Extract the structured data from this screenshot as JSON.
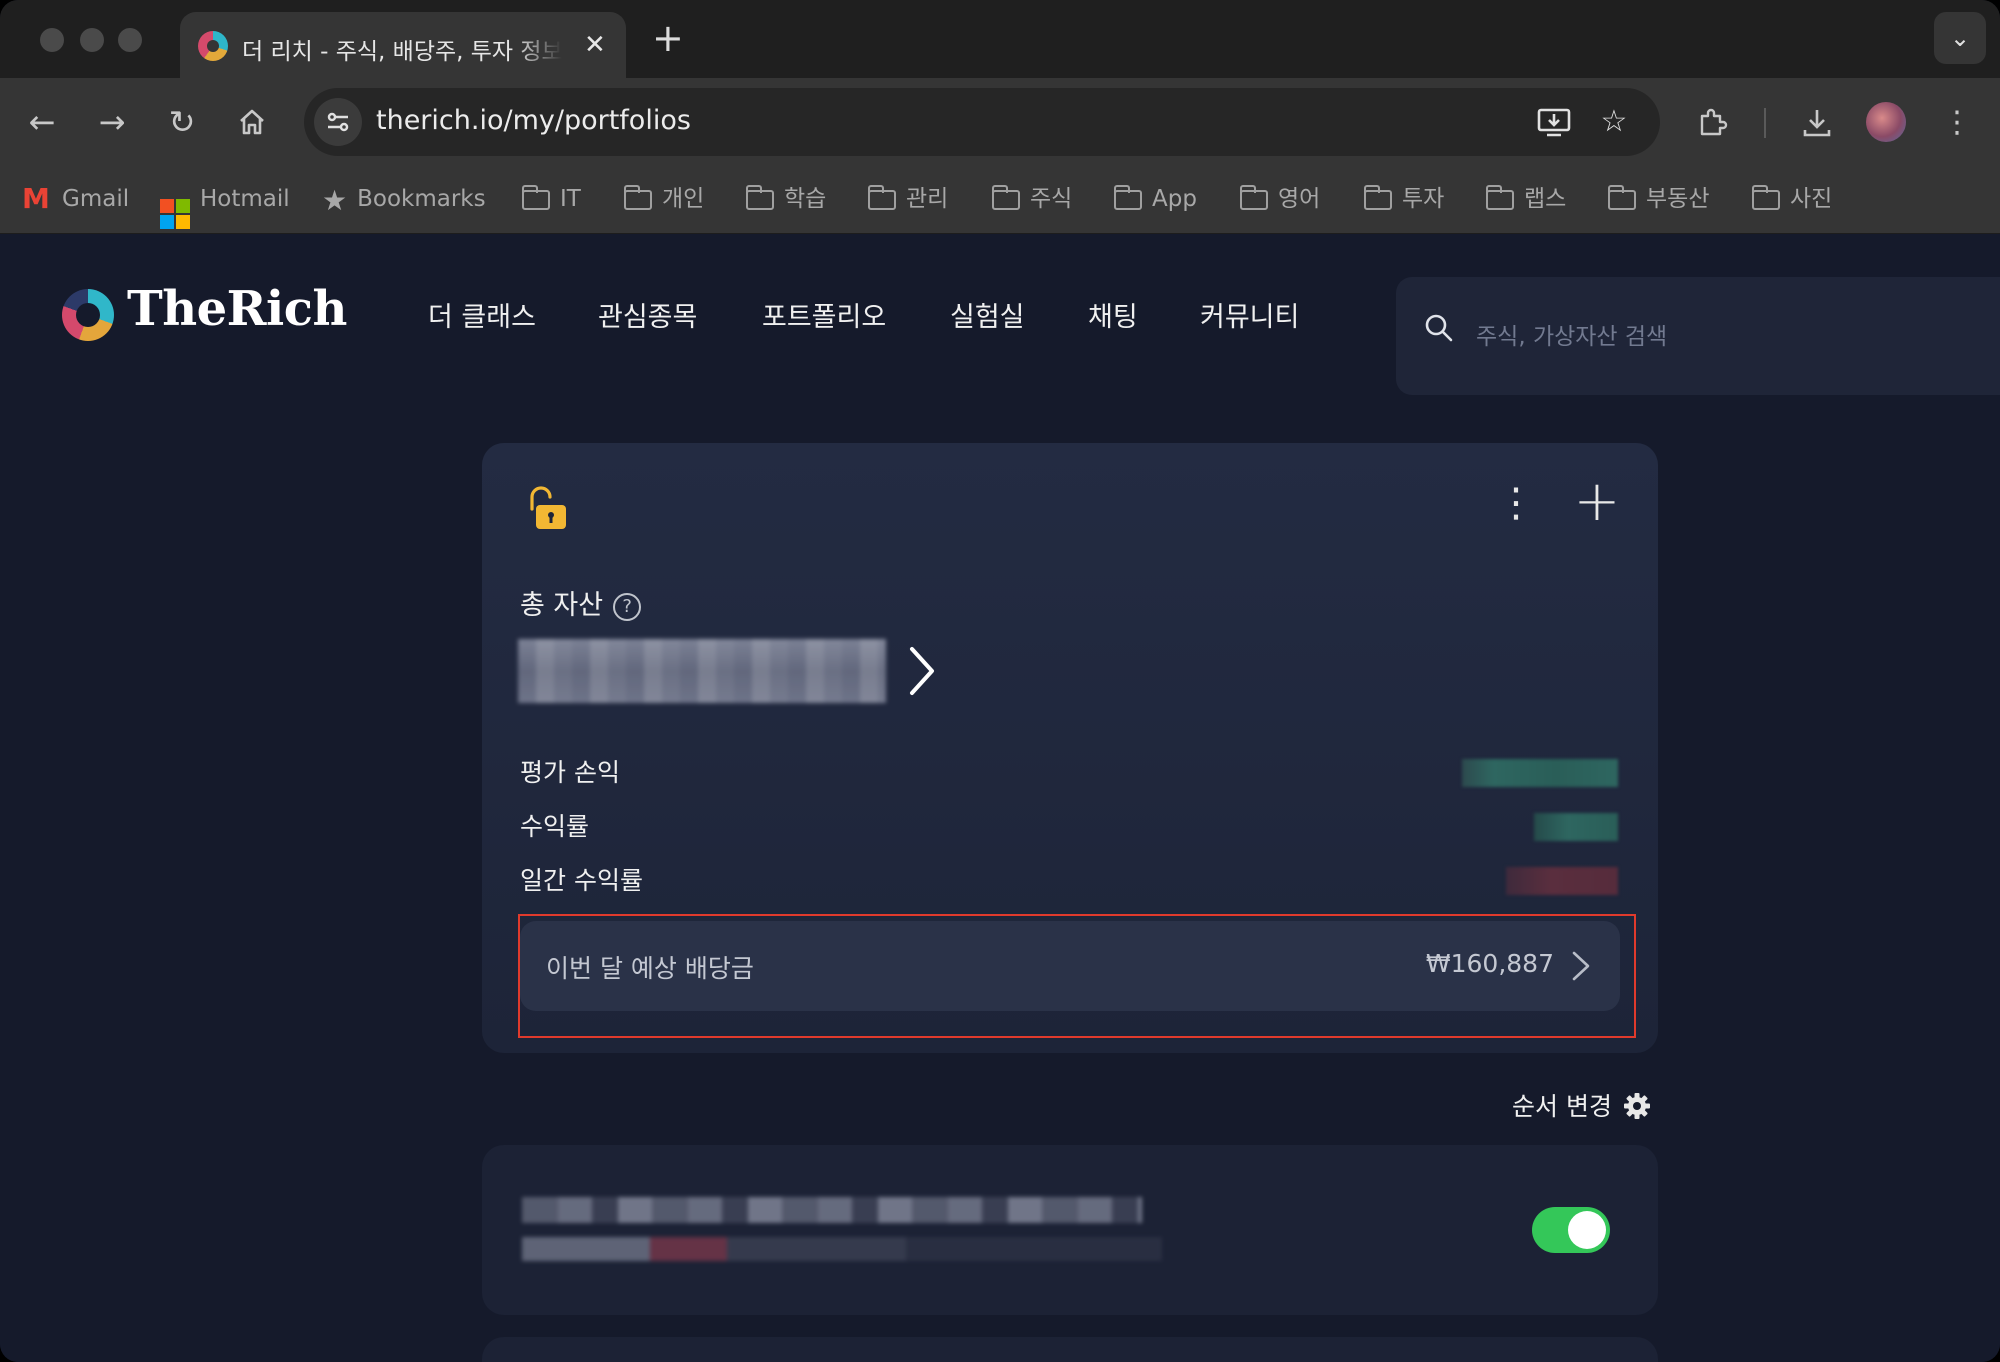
{
  "browser": {
    "tab_title": "더 리치 - 주식, 배당주, 투자 정보, 포트폴리오",
    "tab_close": "✕",
    "new_tab": "+",
    "tab_menu": "⌄",
    "url": "therich.io/my/portfolios",
    "bookmarks": [
      {
        "label": "Gmail",
        "icon": "gmail-icon"
      },
      {
        "label": "Hotmail",
        "icon": "microsoft-icon"
      },
      {
        "label": "Bookmarks",
        "icon": "star-icon"
      },
      {
        "label": "IT",
        "icon": "folder-icon"
      },
      {
        "label": "개인",
        "icon": "folder-icon"
      },
      {
        "label": "학습",
        "icon": "folder-icon"
      },
      {
        "label": "관리",
        "icon": "folder-icon"
      },
      {
        "label": "주식",
        "icon": "folder-icon"
      },
      {
        "label": "App",
        "icon": "folder-icon"
      },
      {
        "label": "영어",
        "icon": "folder-icon"
      },
      {
        "label": "투자",
        "icon": "folder-icon"
      },
      {
        "label": "랩스",
        "icon": "folder-icon"
      },
      {
        "label": "부동산",
        "icon": "folder-icon"
      },
      {
        "label": "사진",
        "icon": "folder-icon"
      }
    ]
  },
  "site": {
    "logo": "TheRich",
    "nav": [
      "더 클래스",
      "관심종목",
      "포트폴리오",
      "실험실",
      "채팅",
      "커뮤니티"
    ],
    "search_placeholder": "주식, 가상자산 검색"
  },
  "portfolio": {
    "total_label": "총 자산",
    "help": "?",
    "rows": [
      "평가 손익",
      "수익률",
      "일간 수익률"
    ],
    "dividend_label": "이번 달 예상 배당금",
    "dividend_value": "₩160,887",
    "reorder_label": "순서 변경",
    "toggle_on": true
  },
  "colors": {
    "accent_green": "#34c759",
    "highlight_red": "#e03a2c",
    "lock_yellow": "#f2b733",
    "page_bg": "#151a2b"
  }
}
